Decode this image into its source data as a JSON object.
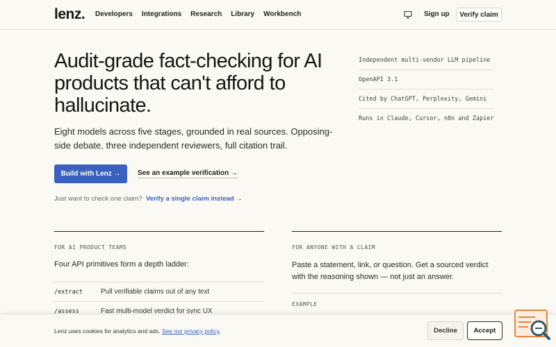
{
  "nav": {
    "logo": "lenz.",
    "links": [
      "Developers",
      "Integrations",
      "Research",
      "Library",
      "Workbench"
    ],
    "signup": "Sign up",
    "verify": "Verify claim"
  },
  "hero": {
    "title": "Audit-grade fact-checking for AI products that can't afford to hallucinate.",
    "subtitle": "Eight models across five stages, grounded in real sources. Opposing-side debate, three independent reviewers, full citation trail.",
    "primary_button": "Build with Lenz →",
    "secondary_button": "See an example verification →",
    "check_prompt": "Just want to check one claim?",
    "check_link": "Verify a single claim instead →"
  },
  "facts": [
    "Independent multi-vendor LLM pipeline",
    "OpenAPI 3.1",
    "Cited by ChatGPT, Perplexity, Gemini",
    "Runs in Claude, Cursor, n8n and Zapier"
  ],
  "teams": {
    "label": "FOR AI PRODUCT TEAMS",
    "intro": "Four API primitives form a depth ladder:",
    "primitives": [
      {
        "name": "/extract",
        "desc": "Pull verifiable claims out of any text"
      },
      {
        "name": "/assess",
        "desc": "Fast multi-model verdict for sync UX"
      }
    ]
  },
  "anyone": {
    "label": "FOR ANYONE WITH A CLAIM",
    "text": "Paste a statement, link, or question. Get a sourced verdict with the reasoning shown — not just an answer.",
    "example_label": "EXAMPLE"
  },
  "cookie": {
    "text": "Lenz uses cookies for analytics and ads.",
    "link": "See our privacy policy",
    "decline": "Decline",
    "accept": "Accept"
  },
  "colors": {
    "accent": "#3a60c0",
    "background": "#fbf9f3",
    "widget": "#e8833a"
  }
}
